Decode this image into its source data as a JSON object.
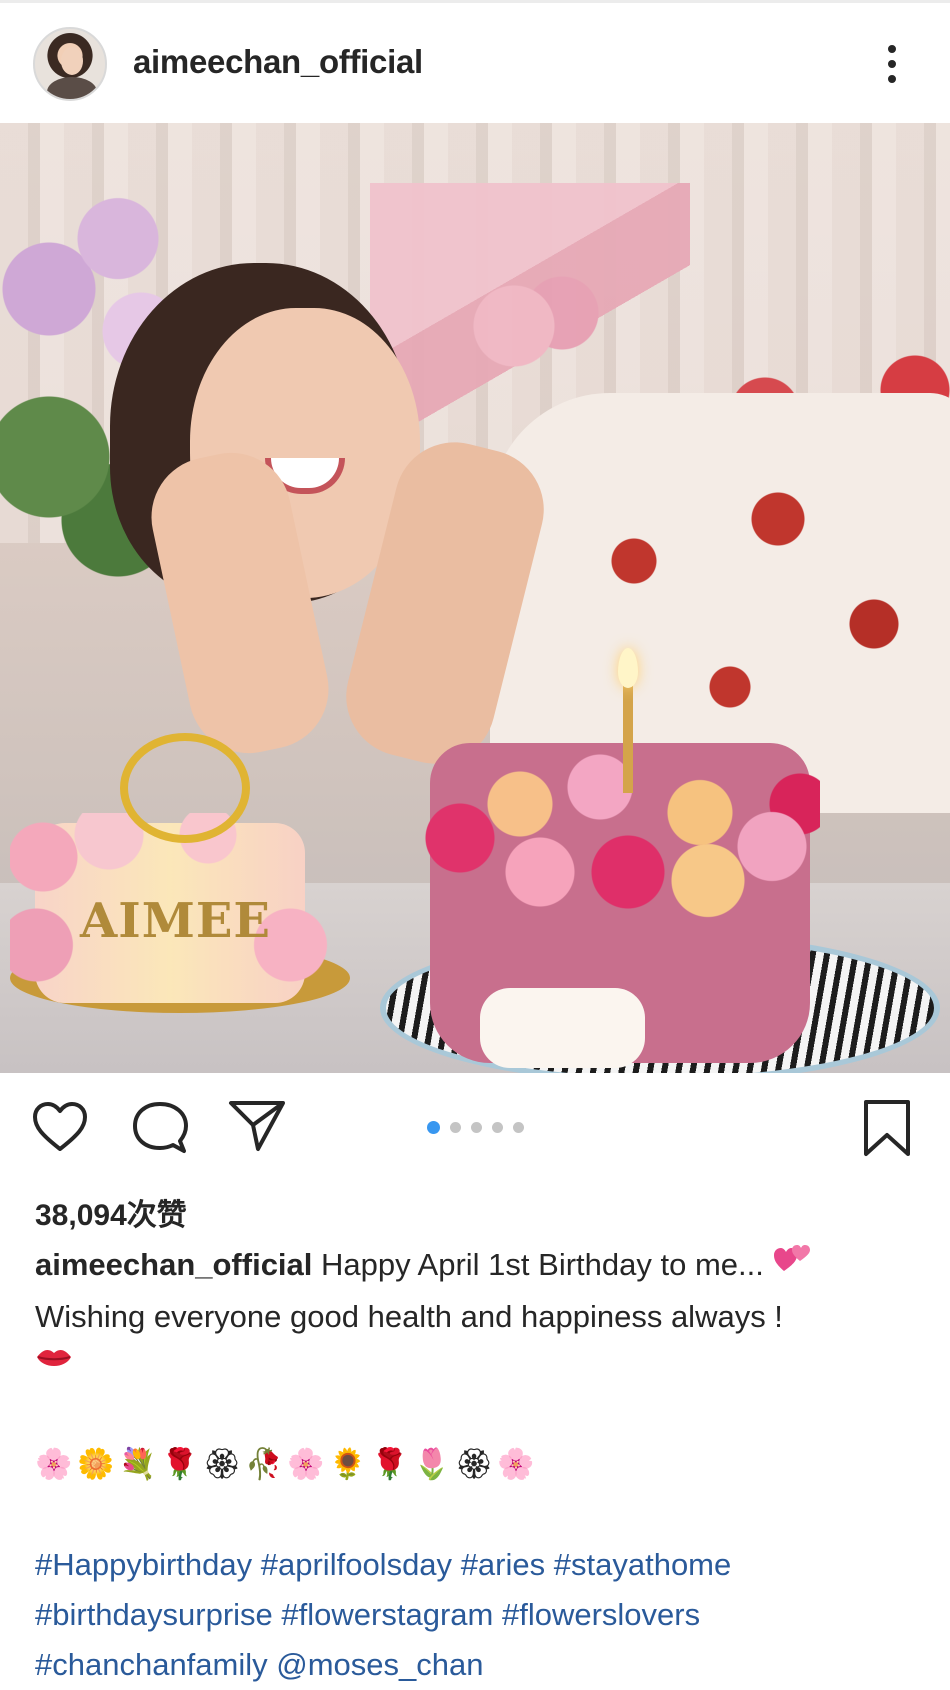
{
  "header": {
    "username": "aimeechan_official"
  },
  "carousel": {
    "total": 5,
    "active_index": 0
  },
  "post": {
    "likes_label": "38,094次赞",
    "caption_user": "aimeechan_official",
    "caption_line1": "Happy April 1st Birthday to me... ",
    "caption_line2": "Wishing everyone good health and happiness always !",
    "emoji_row": [
      "🌸",
      "🌼",
      "💐",
      "🌹",
      "🏵",
      "🥀",
      "🌸",
      "🌻",
      "🌹",
      "🌷",
      "🏵",
      "🌸"
    ],
    "hashtags": [
      "#Happybirthday",
      "#aprilfoolsday",
      "#aries",
      "#stayathome",
      "#birthdaysurprise",
      "#flowerstagram",
      "#flowerslovers",
      "#chanchanfamily",
      "@moses_chan"
    ],
    "cake_name_text": "AIMEE"
  },
  "colors": {
    "link": "#2a5a9a",
    "active_dot": "#3897f0",
    "text": "#262626"
  },
  "icons": {
    "like": "heart-icon",
    "comment": "comment-icon",
    "share": "paper-plane-icon",
    "save": "bookmark-icon",
    "more": "more-vertical-icon"
  }
}
